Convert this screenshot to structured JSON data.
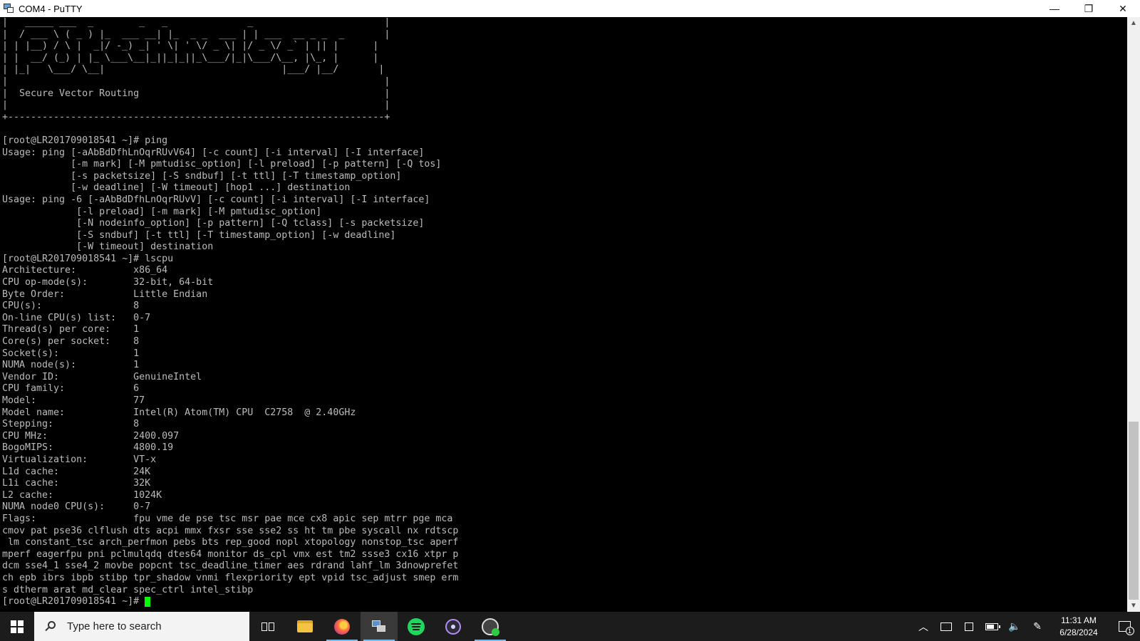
{
  "window": {
    "title": "COM4 - PuTTY",
    "minimize_glyph": "—",
    "restore_glyph": "❐",
    "close_glyph": "✕"
  },
  "terminal": {
    "lines": [
      "|   _____ ___  _        _   _              _                       |",
      "|  / ___ \\ ( _ ) |_  ___ __| |_  _ _  ___ | | ___  __ _ _  _       |",
      "| | |__) / \\ |  _|/ -_) _| ' \\| ' \\/ _ \\| |/ _ \\/ _` | || |      |",
      "| |  __/ (_) | |_ \\___\\__|_||_|_||_\\___/|_|\\___/\\__, |\\_, |      |",
      "| |_|   \\___/ \\__|                               |___/ |__/       |",
      "|                                                                  |",
      "|  Secure Vector Routing                                           |",
      "|                                                                  |",
      "+------------------------------------------------------------------+",
      "",
      "[root@LR201709018541 ~]# ping",
      "Usage: ping [-aAbBdDfhLnOqrRUvV64] [-c count] [-i interval] [-I interface]",
      "            [-m mark] [-M pmtudisc_option] [-l preload] [-p pattern] [-Q tos]",
      "            [-s packetsize] [-S sndbuf] [-t ttl] [-T timestamp_option]",
      "            [-w deadline] [-W timeout] [hop1 ...] destination",
      "Usage: ping -6 [-aAbBdDfhLnOqrRUvV] [-c count] [-i interval] [-I interface]",
      "             [-l preload] [-m mark] [-M pmtudisc_option]",
      "             [-N nodeinfo_option] [-p pattern] [-Q tclass] [-s packetsize]",
      "             [-S sndbuf] [-t ttl] [-T timestamp_option] [-w deadline]",
      "             [-W timeout] destination",
      "[root@LR201709018541 ~]# lscpu",
      "Architecture:          x86_64",
      "CPU op-mode(s):        32-bit, 64-bit",
      "Byte Order:            Little Endian",
      "CPU(s):                8",
      "On-line CPU(s) list:   0-7",
      "Thread(s) per core:    1",
      "Core(s) per socket:    8",
      "Socket(s):             1",
      "NUMA node(s):          1",
      "Vendor ID:             GenuineIntel",
      "CPU family:            6",
      "Model:                 77",
      "Model name:            Intel(R) Atom(TM) CPU  C2758  @ 2.40GHz",
      "Stepping:              8",
      "CPU MHz:               2400.097",
      "BogoMIPS:              4800.19",
      "Virtualization:        VT-x",
      "L1d cache:             24K",
      "L1i cache:             32K",
      "L2 cache:              1024K",
      "NUMA node0 CPU(s):     0-7",
      "Flags:                 fpu vme de pse tsc msr pae mce cx8 apic sep mtrr pge mca",
      "cmov pat pse36 clflush dts acpi mmx fxsr sse sse2 ss ht tm pbe syscall nx rdtscp",
      " lm constant_tsc arch_perfmon pebs bts rep_good nopl xtopology nonstop_tsc aperf",
      "mperf eagerfpu pni pclmulqdq dtes64 monitor ds_cpl vmx est tm2 ssse3 cx16 xtpr p",
      "dcm sse4_1 sse4_2 movbe popcnt tsc_deadline_timer aes rdrand lahf_lm 3dnowprefet",
      "ch epb ibrs ibpb stibp tpr_shadow vnmi flexpriority ept vpid tsc_adjust smep erm",
      "s dtherm arat md_clear spec_ctrl intel_stibp"
    ],
    "prompt": "[root@LR201709018541 ~]# ",
    "text_color": "#bbbbbb",
    "cursor_color": "#00ff00"
  },
  "scrollbar": {
    "up_glyph": "▲",
    "down_glyph": "▼"
  },
  "taskbar": {
    "search_placeholder": "Type here to search",
    "apps": [
      "task-view",
      "file-explorer",
      "firefox",
      "putty",
      "spotify",
      "media-player",
      "vpn-client"
    ],
    "tray": {
      "chevron_glyph": "︿",
      "speaker_glyph": "🔈",
      "pen_glyph": "✎"
    },
    "clock": {
      "time": "11:31 AM",
      "date": "6/28/2024"
    },
    "notification_count": "1"
  }
}
